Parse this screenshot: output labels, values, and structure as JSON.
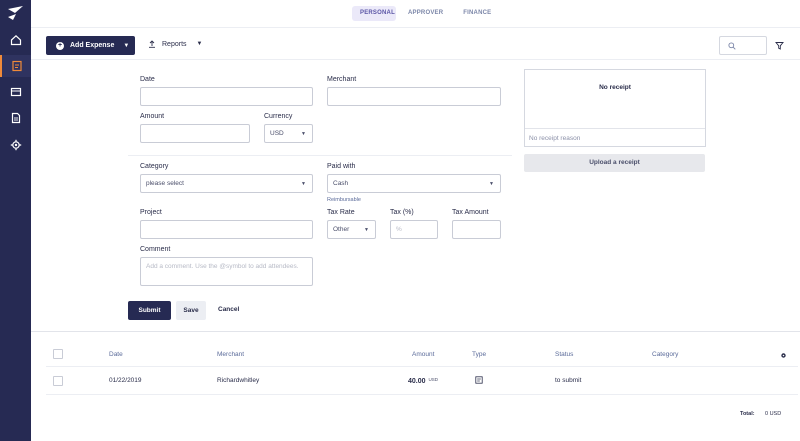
{
  "tabs": [
    {
      "label": "PERSONAL",
      "active": true
    },
    {
      "label": "APPROVER",
      "active": false
    },
    {
      "label": "FINANCE",
      "active": false
    }
  ],
  "sidebar": {
    "items": [
      {
        "icon": "home-icon",
        "active": false
      },
      {
        "icon": "expense-icon",
        "active": true
      },
      {
        "icon": "card-icon",
        "active": false
      },
      {
        "icon": "report-icon",
        "active": false
      },
      {
        "icon": "gear-icon",
        "active": false
      }
    ]
  },
  "toolbar": {
    "add_label": "Add Expense",
    "reports_label": "Reports"
  },
  "form": {
    "date_label": "Date",
    "merchant_label": "Merchant",
    "amount_label": "Amount",
    "currency_label": "Currency",
    "currency_value": "USD",
    "category_label": "Category",
    "category_value": "please select",
    "paid_with_label": "Paid with",
    "paid_with_value": "Cash",
    "reimbursable": "Reimbursable",
    "project_label": "Project",
    "tax_rate_label": "Tax Rate",
    "tax_rate_value": "Other",
    "tax_pct_label": "Tax (%)",
    "tax_pct_placeholder": "%",
    "tax_amount_label": "Tax Amount",
    "comment_label": "Comment",
    "comment_placeholder": "Add a comment. Use the @symbol to add attendees."
  },
  "receipt": {
    "title": "No receipt",
    "reason_placeholder": "No receipt reason",
    "upload_label": "Upload a receipt"
  },
  "actions": {
    "submit": "Submit",
    "save": "Save",
    "cancel": "Cancel"
  },
  "table": {
    "headers": {
      "date": "Date",
      "merchant": "Merchant",
      "amount": "Amount",
      "type": "Type",
      "status": "Status",
      "category": "Category"
    },
    "rows": [
      {
        "date": "01/22/2019",
        "merchant": "Richardwhitley",
        "amount": "40.00",
        "currency": "USD",
        "type_icon": "receipt-icon",
        "status": "to submit",
        "category": ""
      }
    ],
    "total_label": "Total:",
    "total_value": "0 USD"
  },
  "colors": {
    "sidebar_bg": "#262a53",
    "accent": "#f08a3a",
    "primary_btn": "#262a53",
    "tab_active_bg": "#ebe9f9"
  }
}
